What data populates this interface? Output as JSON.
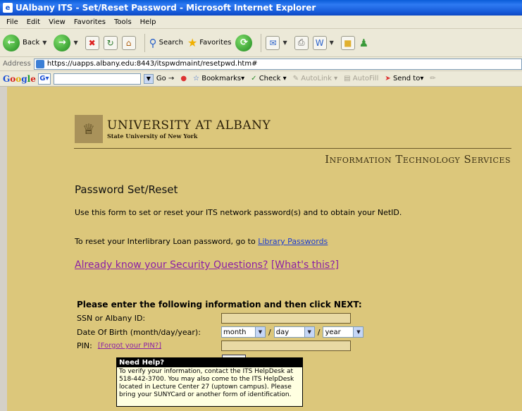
{
  "window": {
    "title": "UAlbany ITS - Set/Reset Password - Microsoft Internet Explorer"
  },
  "menu": [
    "File",
    "Edit",
    "View",
    "Favorites",
    "Tools",
    "Help"
  ],
  "toolbar": {
    "back": "Back",
    "search": "Search",
    "favorites": "Favorites"
  },
  "address": {
    "label": "Address",
    "url": "https://uapps.albany.edu:8443/itspwdmaint/resetpwd.htm#"
  },
  "google": {
    "logo": "Google",
    "go": "Go",
    "bookmarks": "Bookmarks",
    "check": "Check",
    "autolink": "AutoLink",
    "autofill": "AutoFill",
    "sendto": "Send to"
  },
  "page": {
    "university": "UNIVERSITY AT ALBANY",
    "suny": "State University of New York",
    "its": "Information Technology Services",
    "title": "Password Set/Reset",
    "intro": "Use this form to set or reset your ITS network password(s) and to obtain your NetID.",
    "ill_text": "To reset your Interlibrary Loan password, go to ",
    "ill_link": "Library Passwords",
    "security_q": "Already know your Security Questions?",
    "whats_this": "[What's this?]",
    "form_heading": "Please enter the following information and then click NEXT:",
    "ssn_label": "SSN or Albany ID:",
    "dob_label": "Date Of Birth (month/day/year):",
    "month": "month",
    "day": "day",
    "year": "year",
    "pin_label": "PIN:",
    "forgot_pin": "[Forgot your PIN?]"
  },
  "help": {
    "title": "Need Help?",
    "body": "To verify your information, contact the ITS HelpDesk at 518-442-3700. You may also come to the ITS HelpDesk located in Lecture Center 27 (uptown campus). Please bring your SUNYCard or another form of identification."
  }
}
